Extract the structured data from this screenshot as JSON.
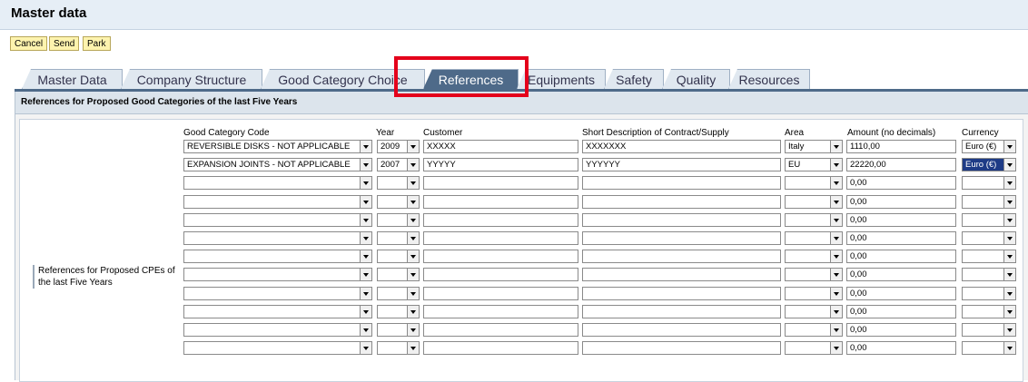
{
  "window": {
    "title": "Master data"
  },
  "toolbar": {
    "cancel": "Cancel",
    "send": "Send",
    "park": "Park"
  },
  "tabs": [
    {
      "label": "Master Data"
    },
    {
      "label": "Company Structure"
    },
    {
      "label": "Good Category Choice"
    },
    {
      "label": "References",
      "active": true
    },
    {
      "label": "Equipments"
    },
    {
      "label": "Safety"
    },
    {
      "label": "Quality"
    },
    {
      "label": "Resources"
    }
  ],
  "section": {
    "title": "References for Proposed Good Categories of the last Five Years",
    "side_label": "References for Proposed CPEs of the last Five Years"
  },
  "table": {
    "columns": [
      "Good Category Code",
      "Year",
      "Customer",
      "Short Description of Contract/Supply",
      "Area",
      "Amount (no decimals)",
      "Currency"
    ],
    "rows": [
      {
        "category": "REVERSIBLE DISKS - NOT APPLICABLE",
        "year": "2009",
        "customer": "XXXXX",
        "description": "XXXXXXX",
        "area": "Italy",
        "amount": "1110,00",
        "currency": "Euro (€)"
      },
      {
        "category": "EXPANSION JOINTS - NOT APPLICABLE",
        "year": "2007",
        "customer": "YYYYY",
        "description": "YYYYYY",
        "area": "EU",
        "amount": "22220,00",
        "currency": "Euro (€)"
      },
      {
        "category": "",
        "year": "",
        "customer": "",
        "description": "",
        "area": "",
        "amount": "0,00",
        "currency": ""
      },
      {
        "category": "",
        "year": "",
        "customer": "",
        "description": "",
        "area": "",
        "amount": "0,00",
        "currency": ""
      },
      {
        "category": "",
        "year": "",
        "customer": "",
        "description": "",
        "area": "",
        "amount": "0,00",
        "currency": ""
      },
      {
        "category": "",
        "year": "",
        "customer": "",
        "description": "",
        "area": "",
        "amount": "0,00",
        "currency": ""
      },
      {
        "category": "",
        "year": "",
        "customer": "",
        "description": "",
        "area": "",
        "amount": "0,00",
        "currency": ""
      },
      {
        "category": "",
        "year": "",
        "customer": "",
        "description": "",
        "area": "",
        "amount": "0,00",
        "currency": ""
      },
      {
        "category": "",
        "year": "",
        "customer": "",
        "description": "",
        "area": "",
        "amount": "0,00",
        "currency": ""
      },
      {
        "category": "",
        "year": "",
        "customer": "",
        "description": "",
        "area": "",
        "amount": "0,00",
        "currency": ""
      },
      {
        "category": "",
        "year": "",
        "customer": "",
        "description": "",
        "area": "",
        "amount": "0,00",
        "currency": ""
      },
      {
        "category": "",
        "year": "",
        "customer": "",
        "description": "",
        "area": "",
        "amount": "0,00",
        "currency": ""
      }
    ]
  },
  "colors": {
    "accent": "#4e6a89",
    "highlight": "#e4001b",
    "button": "#fdf3ae"
  }
}
